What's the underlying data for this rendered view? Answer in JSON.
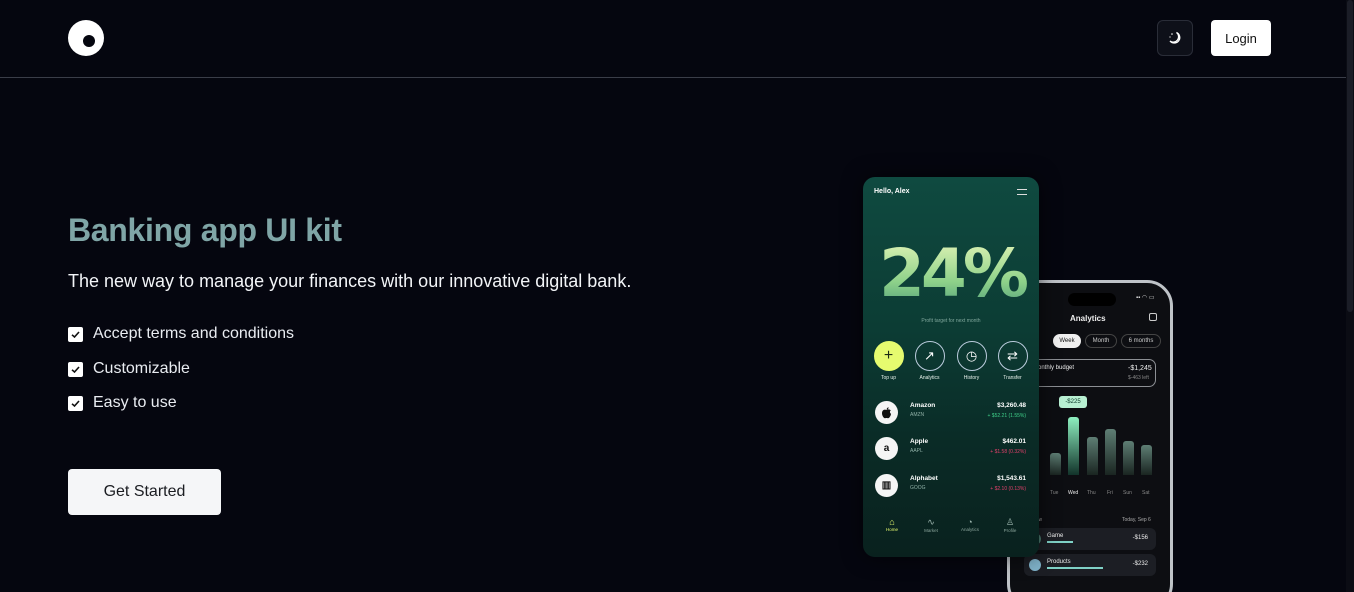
{
  "header": {
    "logo_icon": "crescent-logo-icon",
    "theme_icon": "moon-sparkle-icon",
    "login_label": "Login"
  },
  "hero": {
    "title": "Banking app UI kit",
    "subtitle": "The new way to manage your finances with our innovative digital bank.",
    "features": [
      "Accept terms and conditions",
      "Customizable",
      "Easy to use"
    ],
    "cta_label": "Get Started"
  },
  "front_phone": {
    "greeting": "Hello, Alex",
    "big_percent": "24%",
    "target_caption": "Profit target for next month",
    "actions": [
      {
        "label": "Top up",
        "icon": "plus-icon"
      },
      {
        "label": "Analytics",
        "icon": "trend-icon"
      },
      {
        "label": "History",
        "icon": "clock-icon"
      },
      {
        "label": "Transfer",
        "icon": "transfer-icon"
      }
    ],
    "stocks": [
      {
        "name": "Amazon",
        "ticker": "AMZN",
        "price": "$3,260.48",
        "change": "+ $52.21 (1.55%)",
        "change_color": "#3fd08a",
        "logo": "apple-logo-icon",
        "glyph": ""
      },
      {
        "name": "Apple",
        "ticker": "AAPL",
        "price": "$462.01",
        "change": "+ $1.58 (0.32%)",
        "change_color": "#e0406a",
        "logo": "amazon-logo-icon",
        "glyph": "a"
      },
      {
        "name": "Alphabet",
        "ticker": "GOOG",
        "price": "$1,543.61",
        "change": "+ $2.10 (0.13%)",
        "change_color": "#e0406a",
        "logo": "alphabet-logo-icon",
        "glyph": "▥"
      }
    ],
    "nav": [
      "Home",
      "Market",
      "Analytics",
      "Profile"
    ]
  },
  "back_phone": {
    "title": "Analytics",
    "tabs": [
      "h",
      "Week",
      "Month",
      "6 months"
    ],
    "active_tab": "Week",
    "budget_label": "onthly budget",
    "budget_value": "-$1,245",
    "budget_sub": "$-463 left",
    "tooltip": "-$225",
    "days": [
      "n",
      "Tue",
      "Wed",
      "Thu",
      "Fri",
      "Sun",
      "Sat"
    ],
    "active_day": "Wed",
    "overview_label": "view",
    "overview_date": "Today, Sep 6",
    "rows": [
      {
        "name": "Game",
        "value": "-$156"
      },
      {
        "name": "Products",
        "value": "-$232"
      }
    ]
  }
}
